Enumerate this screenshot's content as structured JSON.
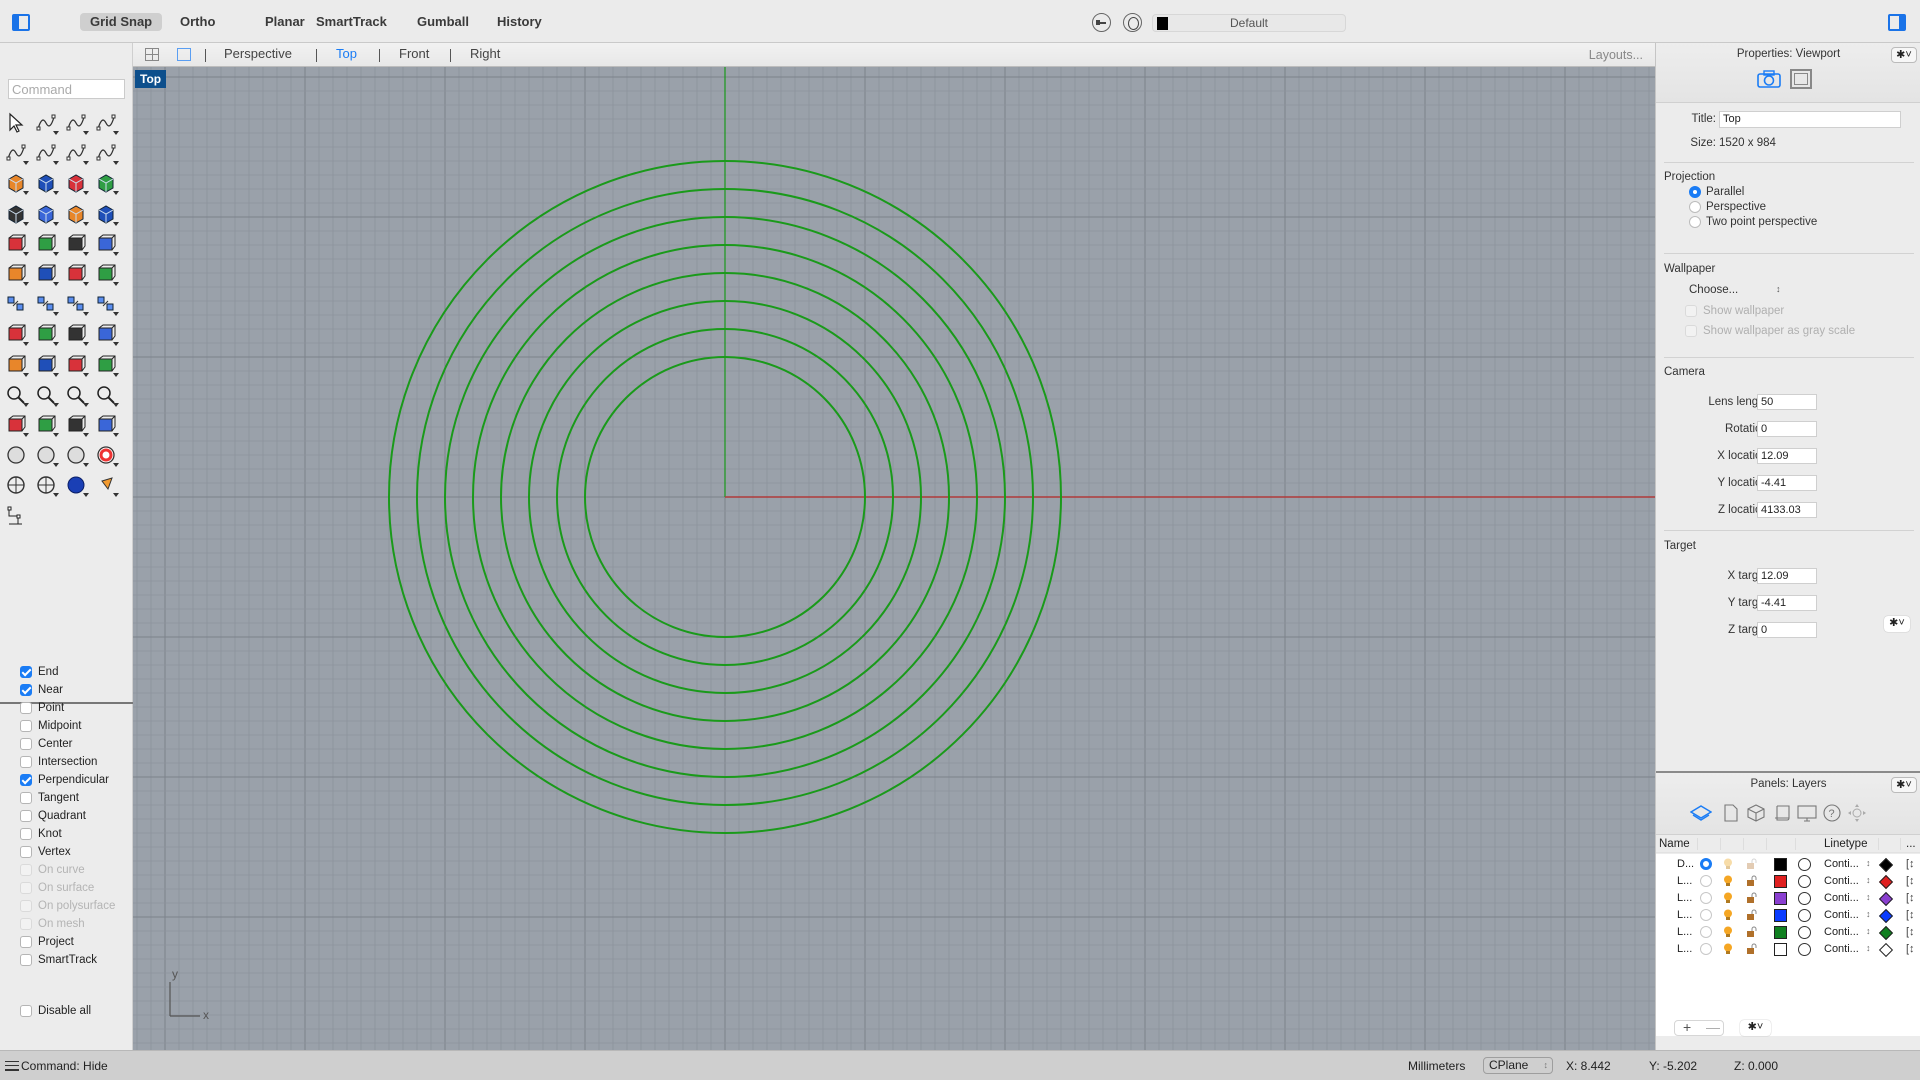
{
  "toolbar": {
    "modes": [
      {
        "label": "Grid Snap",
        "active": true
      },
      {
        "label": "Ortho",
        "active": false
      },
      {
        "label": "Planar",
        "active": false
      },
      {
        "label": "SmartTrack",
        "active": false
      },
      {
        "label": "Gumball",
        "active": false
      },
      {
        "label": "History",
        "active": false
      }
    ],
    "current_layer": "Default",
    "current_layer_color": "#000000"
  },
  "command": {
    "placeholder": "Command",
    "status": "Command: Hide"
  },
  "tools": [
    "select-arrow",
    "point",
    "polyline",
    "curve",
    "circle",
    "ellipse",
    "arc",
    "rectangle",
    "polygon",
    "fillet-curve",
    "surface-from-points",
    "loft-surface",
    "box-solid",
    "sphere-solid",
    "cylinder-pipe",
    "surface-patch",
    "solid-tools",
    "explode",
    "split",
    "trim",
    "boolean-union",
    "boolean-difference",
    "offset-curve",
    "extend-curve",
    "text",
    "scale",
    "array",
    "mirror",
    "extrude",
    "extrude-surface",
    "grid-array",
    "analyze-direction",
    "mesh-tools",
    "check",
    "render-shapes",
    "surface-analysis",
    "zoom-in-out",
    "zoom-window",
    "zoom-extents",
    "zoom-selected",
    "rotate-view",
    "block-car",
    "cplane",
    "shapes-align",
    "lights",
    "lock",
    "materials",
    "color-wheel",
    "render-sphere",
    "render-sphere-grid",
    "blue-sphere",
    "cone-light",
    "dimensions"
  ],
  "osnaps": [
    {
      "label": "End",
      "checked": true,
      "enabled": true
    },
    {
      "label": "Near",
      "checked": true,
      "enabled": true
    },
    {
      "label": "Point",
      "checked": false,
      "enabled": true
    },
    {
      "label": "Midpoint",
      "checked": false,
      "enabled": true
    },
    {
      "label": "Center",
      "checked": false,
      "enabled": true
    },
    {
      "label": "Intersection",
      "checked": false,
      "enabled": true
    },
    {
      "label": "Perpendicular",
      "checked": true,
      "enabled": true
    },
    {
      "label": "Tangent",
      "checked": false,
      "enabled": true
    },
    {
      "label": "Quadrant",
      "checked": false,
      "enabled": true
    },
    {
      "label": "Knot",
      "checked": false,
      "enabled": true
    },
    {
      "label": "Vertex",
      "checked": false,
      "enabled": true
    },
    {
      "label": "On curve",
      "checked": false,
      "enabled": false
    },
    {
      "label": "On surface",
      "checked": false,
      "enabled": false
    },
    {
      "label": "On polysurface",
      "checked": false,
      "enabled": false
    },
    {
      "label": "On mesh",
      "checked": false,
      "enabled": false
    },
    {
      "label": "Project",
      "checked": false,
      "enabled": true
    },
    {
      "label": "SmartTrack",
      "checked": false,
      "enabled": true
    },
    {
      "label": "Disable all",
      "checked": false,
      "enabled": true
    }
  ],
  "viewport_tabs": {
    "tabs": [
      {
        "label": "Perspective",
        "active": false
      },
      {
        "label": "Top",
        "active": true
      },
      {
        "label": "Front",
        "active": false
      },
      {
        "label": "Right",
        "active": false
      }
    ],
    "layouts_label": "Layouts..."
  },
  "viewport": {
    "label": "Top",
    "axis_x_label": "x",
    "axis_y_label": "y",
    "curve_color": "#1a9a1a",
    "x_axis_color": "#b03a3a",
    "y_axis_color": "#1a9a1a",
    "grid_color": "#8c939c",
    "circles": {
      "count": 8,
      "center": [
        0,
        0
      ]
    }
  },
  "properties": {
    "title": "Properties: Viewport",
    "title_label": "Title:",
    "title_value": "Top",
    "size_label": "Size:",
    "size_value": "1520 x 984",
    "projection": {
      "heading": "Projection",
      "options": [
        {
          "label": "Parallel",
          "selected": true
        },
        {
          "label": "Perspective",
          "selected": false
        },
        {
          "label": "Two point perspective",
          "selected": false
        }
      ]
    },
    "wallpaper": {
      "heading": "Wallpaper",
      "choose_label": "Choose...",
      "show_wallpaper": "Show wallpaper",
      "show_gray": "Show wallpaper as gray scale"
    },
    "camera": {
      "heading": "Camera",
      "fields": [
        {
          "label": "Lens length:",
          "value": "50"
        },
        {
          "label": "Rotation:",
          "value": "0"
        },
        {
          "label": "X location:",
          "value": "12.09"
        },
        {
          "label": "Y location:",
          "value": "-4.41"
        },
        {
          "label": "Z location:",
          "value": "4133.03"
        }
      ]
    },
    "target": {
      "heading": "Target",
      "fields": [
        {
          "label": "X target:",
          "value": "12.09"
        },
        {
          "label": "Y target:",
          "value": "-4.41"
        },
        {
          "label": "Z target:",
          "value": "0"
        }
      ]
    }
  },
  "layers": {
    "title": "Panels: Layers",
    "columns": {
      "name": "Name",
      "linetype": "Linetype",
      "more": "..."
    },
    "rows": [
      {
        "name": "D...",
        "current": true,
        "on": false,
        "locked": false,
        "color": "#000000",
        "linetype": "Conti...",
        "print_color": "#000000"
      },
      {
        "name": "L...",
        "current": false,
        "on": true,
        "locked": true,
        "color": "#e02020",
        "linetype": "Conti...",
        "print_color": "#e02020"
      },
      {
        "name": "L...",
        "current": false,
        "on": true,
        "locked": true,
        "color": "#8a3fd0",
        "linetype": "Conti...",
        "print_color": "#8a3fd0"
      },
      {
        "name": "L...",
        "current": false,
        "on": true,
        "locked": true,
        "color": "#0a3cff",
        "linetype": "Conti...",
        "print_color": "#0a3cff"
      },
      {
        "name": "L...",
        "current": false,
        "on": true,
        "locked": true,
        "color": "#108020",
        "linetype": "Conti...",
        "print_color": "#108020"
      },
      {
        "name": "L...",
        "current": false,
        "on": true,
        "locked": true,
        "color": "#ffffff",
        "linetype": "Conti...",
        "print_color": "#ffffff"
      }
    ]
  },
  "statusbar": {
    "units": "Millimeters",
    "cplane": "CPlane",
    "x": "X: 8.442",
    "y": "Y: -5.202",
    "z": "Z: 0.000"
  },
  "icons": {
    "gear": "✱˅",
    "width_step": "[↕"
  }
}
